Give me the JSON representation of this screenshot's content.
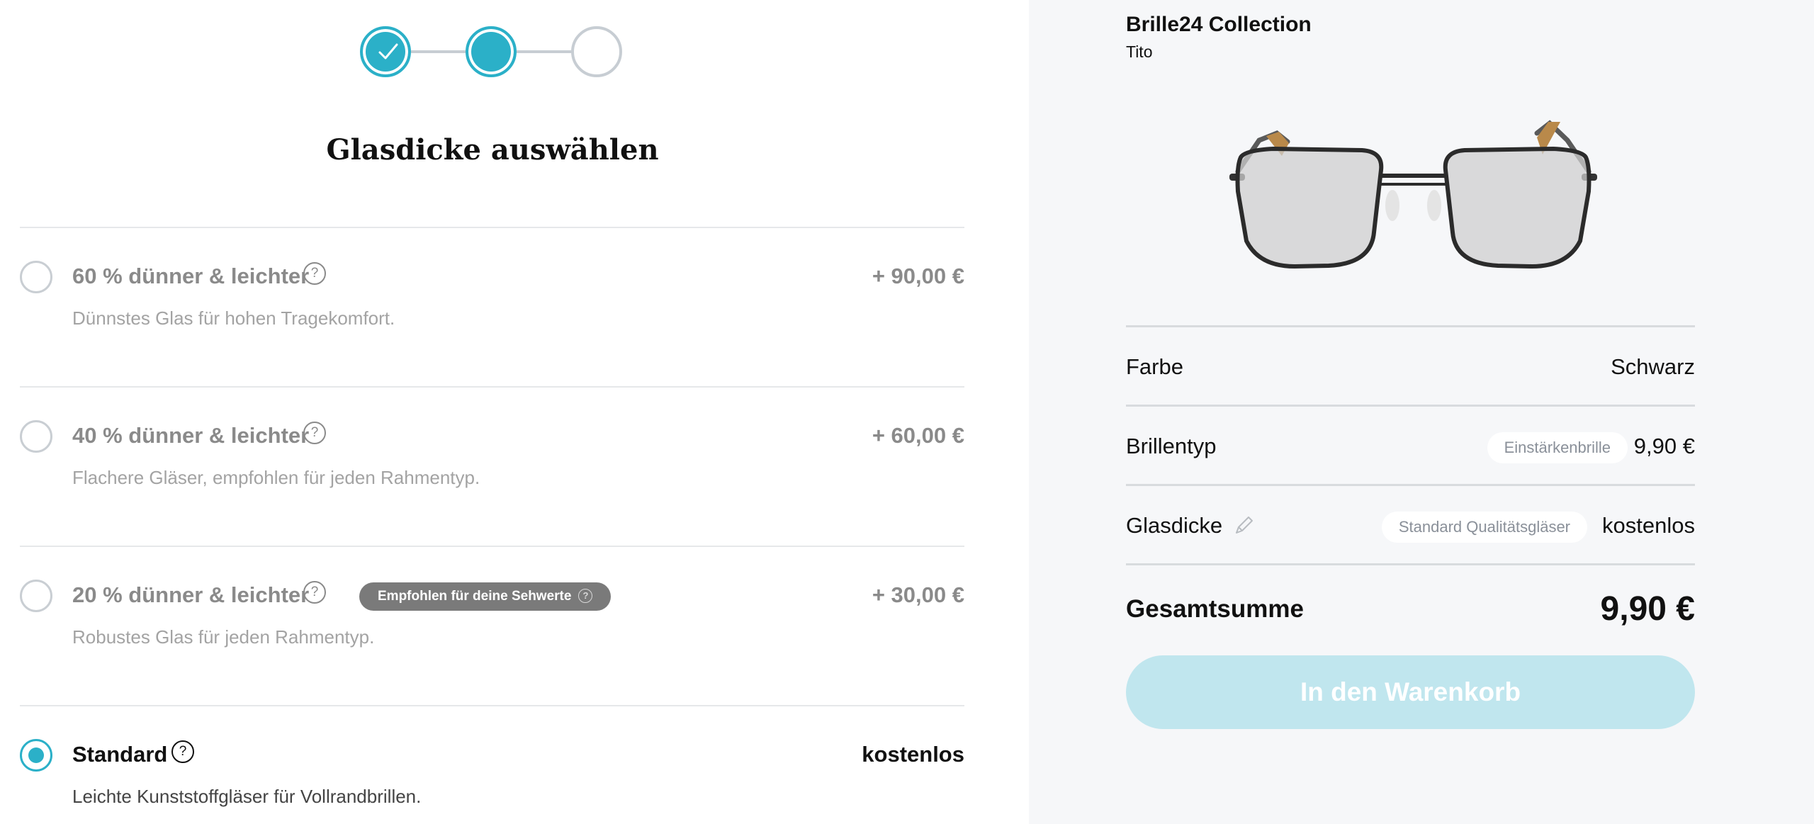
{
  "stepper": {
    "steps": [
      {
        "state": "done",
        "icon": "check-icon"
      },
      {
        "state": "current"
      },
      {
        "state": "todo"
      }
    ],
    "accent_color": "#2bb0c8",
    "inactive_color": "#c7cdd3"
  },
  "left": {
    "title": "Glasdicke auswählen",
    "options": [
      {
        "title": "60 % dünner & leichter",
        "desc": "Dünnstes Glas für hohen Tragekomfort.",
        "price": "+ 90,00 €",
        "selected": false
      },
      {
        "title": "40 % dünner & leichter",
        "desc": "Flachere Gläser, empfohlen für jeden Rahmentyp.",
        "price": "+ 60,00 €",
        "selected": false
      },
      {
        "title": "20 % dünner & leichter",
        "desc": "Robustes Glas für jeden Rahmentyp.",
        "price": "+ 30,00 €",
        "selected": false,
        "badge": "Empfohlen für deine Sehwerte"
      },
      {
        "title": "Standard",
        "desc": "Leichte Kunststoffgläser für Vollrandbrillen.",
        "price": "kostenlos",
        "selected": true
      }
    ],
    "help_glyph": "?"
  },
  "right": {
    "brand": "Brille24 Collection",
    "model": "Tito",
    "summary": {
      "color": {
        "label": "Farbe",
        "value": "Schwarz"
      },
      "type": {
        "label": "Brillentyp",
        "chip": "Einstärkenbrille",
        "value": "9,90 €"
      },
      "thickness": {
        "label": "Glasdicke",
        "chip": "Standard Qualitätsgläser",
        "value": "kostenlos"
      },
      "total": {
        "label": "Gesamtsumme",
        "value": "9,90 €"
      }
    },
    "cart_button": "In den Warenkorb",
    "button_color": "#c0e6ee"
  }
}
